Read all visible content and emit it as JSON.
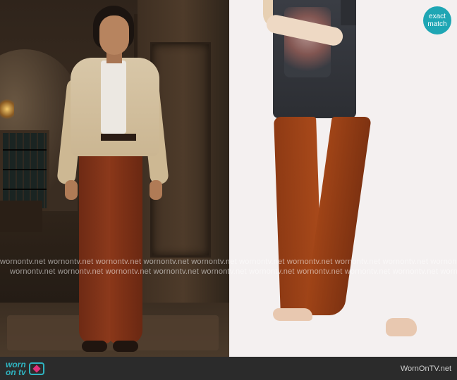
{
  "badge": {
    "line1": "exact",
    "line2": "match"
  },
  "watermark": {
    "text": "wornontv.net wornontv.net wornontv.net wornontv.net wornontv.net wornontv.net wornontv.net wornontv.net wornontv.net wornontv.net"
  },
  "footer": {
    "logo_line1": "worn",
    "logo_line2": "on tv",
    "site": "WornOnTV.net"
  },
  "colors": {
    "accent": "#1fa6b4",
    "logo": "#2fb3c0",
    "logo_pink": "#e0317a",
    "footer_bg": "#2b2b2b"
  }
}
